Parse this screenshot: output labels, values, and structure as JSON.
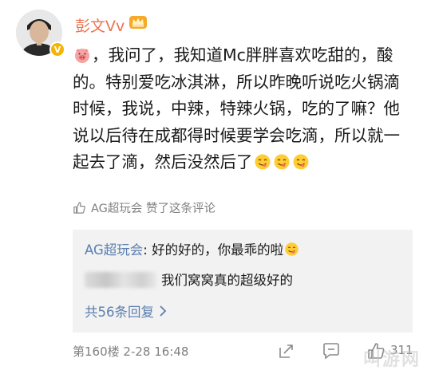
{
  "user": {
    "name": "彭文Vv",
    "verified_mark": "V"
  },
  "comment": {
    "prefix": "，我问了，我知道Mc胖胖喜欢吃甜的，酸的。特别爱吃冰淇淋，所以昨晚听说吃火锅滴时候，我说，中辣，特辣火锅，吃的了嘛？他说以后待在成都得时候要学会吃滴，所以就一起去了滴，然后没然后了"
  },
  "likes": {
    "text": "AG超玩会 赞了这条评论"
  },
  "replies": {
    "items": [
      {
        "author": "AG超玩会",
        "separator": ": ",
        "text": "好的好的，你最乖的啦"
      },
      {
        "author_blurred": true,
        "text": "我们窝窝真的超级好的"
      }
    ],
    "more_label": "共56条回复"
  },
  "footer": {
    "floor": "第160楼",
    "time": "2-28 16:48",
    "like_count": "311"
  },
  "watermark": "叫游网",
  "colors": {
    "username": "#eb7350",
    "link": "#5b7faf",
    "secondary": "#808080",
    "reply_bg": "#f2f2f2"
  }
}
